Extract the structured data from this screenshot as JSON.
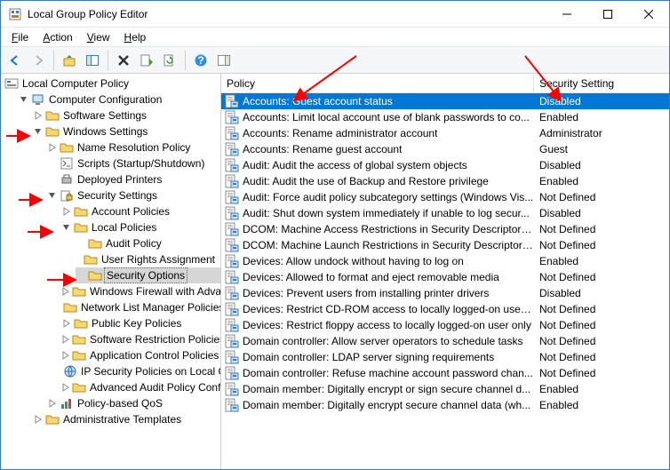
{
  "window": {
    "title": "Local Group Policy Editor"
  },
  "menu": {
    "file": "File",
    "action": "Action",
    "view": "View",
    "help": "Help"
  },
  "toolbar_icons": {
    "back": "back",
    "forward": "forward",
    "up": "up",
    "show_hide_tree": "show-hide-tree",
    "delete": "delete",
    "properties": "properties",
    "export": "export",
    "refresh": "refresh",
    "help": "help",
    "preview": "preview"
  },
  "tree": {
    "root": "Local Computer Policy",
    "computer_cfg": "Computer Configuration",
    "software_settings": "Software Settings",
    "windows_settings": "Windows Settings",
    "name_resolution_policy": "Name Resolution Policy",
    "scripts": "Scripts (Startup/Shutdown)",
    "deployed_printers": "Deployed Printers",
    "security_settings": "Security Settings",
    "account_policies": "Account Policies",
    "local_policies": "Local Policies",
    "audit_policy": "Audit Policy",
    "user_rights": "User Rights Assignment",
    "security_options": "Security Options",
    "windows_firewall": "Windows Firewall with Advanced Security",
    "network_list": "Network List Manager Policies",
    "public_key": "Public Key Policies",
    "software_restriction": "Software Restriction Policies",
    "app_control": "Application Control Policies",
    "ip_security": "IP Security Policies on Local Computer",
    "advanced_audit": "Advanced Audit Policy Configuration",
    "policy_qos": "Policy-based QoS",
    "admin_templates": "Administrative Templates"
  },
  "columns": {
    "policy": "Policy",
    "setting": "Security Setting"
  },
  "selected_index": 0,
  "policies": [
    {
      "name": "Accounts: Guest account status",
      "setting": "Disabled"
    },
    {
      "name": "Accounts: Limit local account use of blank passwords to co...",
      "setting": "Enabled"
    },
    {
      "name": "Accounts: Rename administrator account",
      "setting": "Administrator"
    },
    {
      "name": "Accounts: Rename guest account",
      "setting": "Guest"
    },
    {
      "name": "Audit: Audit the access of global system objects",
      "setting": "Disabled"
    },
    {
      "name": "Audit: Audit the use of Backup and Restore privilege",
      "setting": "Enabled"
    },
    {
      "name": "Audit: Force audit policy subcategory settings (Windows Vis...",
      "setting": "Not Defined"
    },
    {
      "name": "Audit: Shut down system immediately if unable to log secur...",
      "setting": "Disabled"
    },
    {
      "name": "DCOM: Machine Access Restrictions in Security Descriptor D...",
      "setting": "Not Defined"
    },
    {
      "name": "DCOM: Machine Launch Restrictions in Security Descriptor ...",
      "setting": "Not Defined"
    },
    {
      "name": "Devices: Allow undock without having to log on",
      "setting": "Enabled"
    },
    {
      "name": "Devices: Allowed to format and eject removable media",
      "setting": "Not Defined"
    },
    {
      "name": "Devices: Prevent users from installing printer drivers",
      "setting": "Disabled"
    },
    {
      "name": "Devices: Restrict CD-ROM access to locally logged-on user ...",
      "setting": "Not Defined"
    },
    {
      "name": "Devices: Restrict floppy access to locally logged-on user only",
      "setting": "Not Defined"
    },
    {
      "name": "Domain controller: Allow server operators to schedule tasks",
      "setting": "Not Defined"
    },
    {
      "name": "Domain controller: LDAP server signing requirements",
      "setting": "Not Defined"
    },
    {
      "name": "Domain controller: Refuse machine account password chan...",
      "setting": "Not Defined"
    },
    {
      "name": "Domain member: Digitally encrypt or sign secure channel d...",
      "setting": "Enabled"
    },
    {
      "name": "Domain member: Digitally encrypt secure channel data (wh...",
      "setting": "Enabled"
    }
  ]
}
